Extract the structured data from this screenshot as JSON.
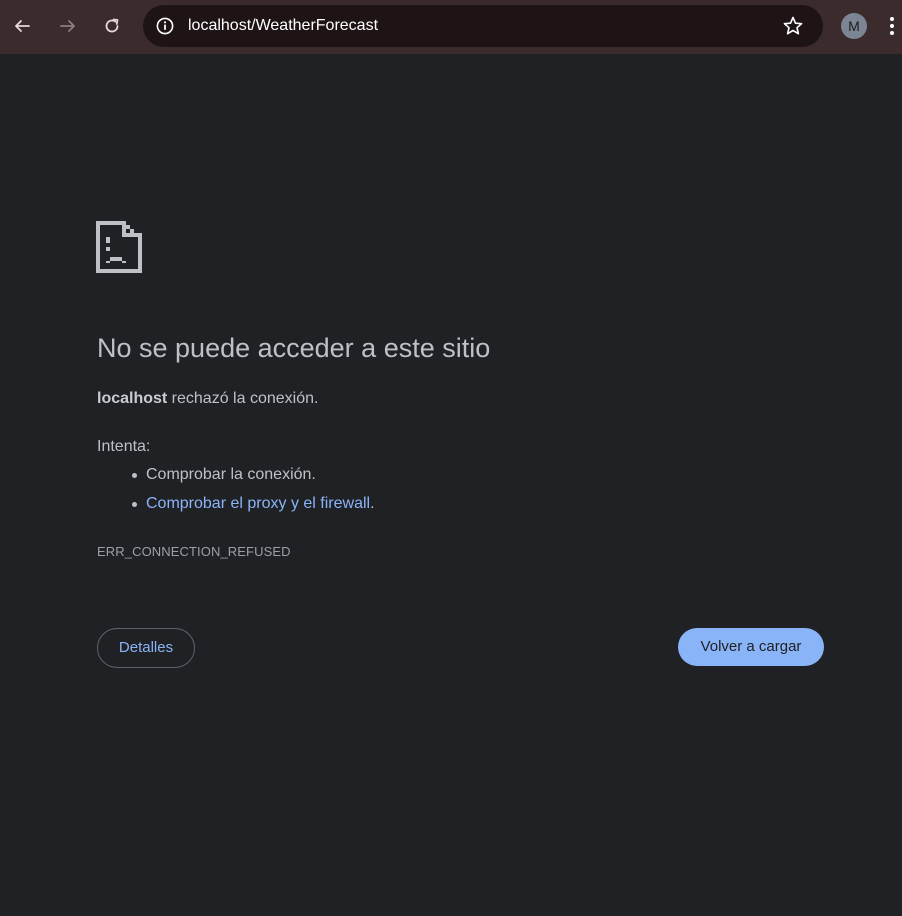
{
  "browser": {
    "url": "localhost/WeatherForecast",
    "profile_initial": "M",
    "icons": {
      "back": "arrow-left-icon",
      "forward": "arrow-right-icon",
      "reload": "reload-icon",
      "site_info": "info-icon",
      "bookmark": "star-icon",
      "menu": "kebab-menu-icon"
    }
  },
  "error_page": {
    "icon": "sad-document-icon",
    "title": "No se puede acceder a este sitio",
    "host": "localhost",
    "message_suffix": " rechazó la conexión.",
    "try_label": "Intenta:",
    "suggestions": [
      {
        "text": "Comprobar la conexión.",
        "link": false
      },
      {
        "link_text": "Comprobar el proxy y el firewall",
        "suffix": ".",
        "link": true
      }
    ],
    "error_code": "ERR_CONNECTION_REFUSED",
    "details_button": "Detalles",
    "reload_button": "Volver a cargar"
  },
  "colors": {
    "background": "#202124",
    "toolbar": "#3c2b2d",
    "omnibox": "#1e1416",
    "text_primary": "#bdc1c6",
    "link": "#8ab4f8",
    "button_primary_bg": "#8ab4f8"
  }
}
